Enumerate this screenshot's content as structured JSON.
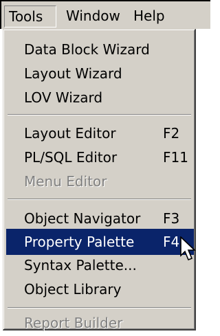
{
  "menubar": {
    "items": [
      {
        "label": "Tools"
      },
      {
        "label": "Window"
      },
      {
        "label": "Help"
      }
    ]
  },
  "tools_menu": {
    "open_menu": "Tools",
    "selected_item": "Property Palette",
    "groups": [
      [
        {
          "label": "Data Block Wizard",
          "accel": "",
          "enabled": true
        },
        {
          "label": "Layout Wizard",
          "accel": "",
          "enabled": true
        },
        {
          "label": "LOV Wizard",
          "accel": "",
          "enabled": true
        }
      ],
      [
        {
          "label": "Layout Editor",
          "accel": "F2",
          "enabled": true
        },
        {
          "label": "PL/SQL Editor",
          "accel": "F11",
          "enabled": true
        },
        {
          "label": "Menu Editor",
          "accel": "",
          "enabled": false
        }
      ],
      [
        {
          "label": "Object Navigator",
          "accel": "F3",
          "enabled": true
        },
        {
          "label": "Property Palette",
          "accel": "F4",
          "enabled": true
        },
        {
          "label": "Syntax Palette...",
          "accel": "",
          "enabled": true
        },
        {
          "label": "Object Library",
          "accel": "",
          "enabled": true
        }
      ],
      [
        {
          "label": "Report Builder",
          "accel": "",
          "enabled": false
        }
      ]
    ]
  },
  "cursor": {
    "icon": "arrow-cursor-icon"
  }
}
